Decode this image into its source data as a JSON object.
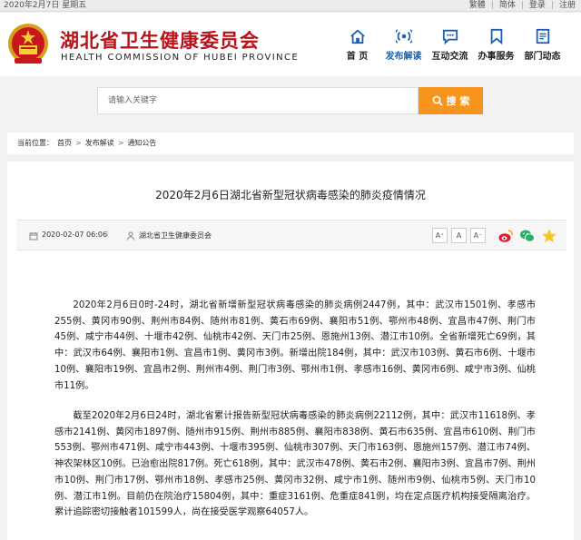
{
  "topbar": {
    "date": "2020年2月7日 星期五",
    "links": [
      "繁體",
      "简体",
      "登录",
      "注册"
    ]
  },
  "header": {
    "title": "湖北省卫生健康委员会",
    "subtitle": "HEALTH COMMISSION OF HUBEI PROVINCE"
  },
  "nav": [
    {
      "label": "首  页",
      "icon": "home-icon",
      "active": false
    },
    {
      "label": "发布解读",
      "icon": "broadcast-icon",
      "active": true
    },
    {
      "label": "互动交流",
      "icon": "chat-icon",
      "active": false
    },
    {
      "label": "办事服务",
      "icon": "bookmark-icon",
      "active": false
    },
    {
      "label": "部门动态",
      "icon": "document-icon",
      "active": false
    }
  ],
  "search": {
    "placeholder": "请输入关键字",
    "button_label": "搜 索"
  },
  "breadcrumb": {
    "prefix": "当前位置：",
    "items": [
      "首页",
      "发布解读",
      "通知公告"
    ]
  },
  "article": {
    "title": "2020年2月6日湖北省新型冠状病毒感染的肺炎疫情情况",
    "date": "2020-02-07 06:06",
    "source": "湖北省卫生健康委员会",
    "font_buttons": [
      "A⁺",
      "A",
      "A⁻"
    ],
    "paragraphs": [
      "2020年2月6日0时-24时，湖北省新增新型冠状病毒感染的肺炎病例2447例，其中：武汉市1501例、孝感市255例、黄冈市90例、荆州市84例、随州市81例、黄石市69例、襄阳市51例、鄂州市48例、宜昌市47例、荆门市45例、咸宁市44例、十堰市42例、仙桃市42例、天门市25例、恩施州13例、潜江市10例。全省新增死亡69例，其中：武汉市64例、襄阳市1例、宜昌市1例、黄冈市3例。新增出院184例，其中：武汉市103例、黄石市6例、十堰市10例、襄阳市19例、宜昌市2例、荆州市4例、荆门市3例、鄂州市1例、孝感市16例、黄冈市6例、咸宁市3例、仙桃市11例。",
      "截至2020年2月6日24时，湖北省累计报告新型冠状病毒感染的肺炎病例22112例，其中：武汉市11618例、孝感市2141例、黄冈市1897例、随州市915例、荆州市885例、襄阳市838例、黄石市635例、宜昌市610例、荆门市553例、鄂州市471例、咸宁市443例、十堰市395例、仙桃市307例、天门市163例、恩施州157例、潜江市74例、神农架林区10例。已治愈出院817例。死亡618例，其中：武汉市478例、黄石市2例、襄阳市3例、宜昌市7例、荆州市10例、荆门市17例、鄂州市18例、孝感市25例、黄冈市32例、咸宁市1例、随州市9例、仙桃市5例、天门市10例、潜江市1例。目前仍在院治疗15804例，其中：重症3161例、危重症841例，均在定点医疗机构接受隔离治疗。累计追踪密切接触者101599人，尚在接受医学观察64057人。"
    ]
  },
  "colors": {
    "brand_red": "#b8121b",
    "nav_active": "#1a5fb4",
    "search_orange": "#f7941d"
  }
}
